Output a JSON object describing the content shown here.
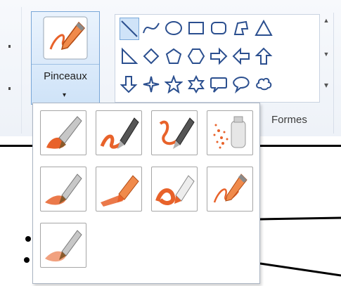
{
  "ribbon": {
    "brushes_button": {
      "label": "Pinceaux",
      "caret": "▾",
      "icon": "brush-pen-icon"
    },
    "shapes_group": {
      "label": "Formes",
      "shapes": [
        {
          "name": "line-icon",
          "selected": true
        },
        {
          "name": "curve-icon"
        },
        {
          "name": "oval-icon"
        },
        {
          "name": "rectangle-icon"
        },
        {
          "name": "rounded-rectangle-icon"
        },
        {
          "name": "polygon-icon"
        },
        {
          "name": "triangle-icon"
        },
        {
          "name": "right-triangle-icon"
        },
        {
          "name": "diamond-icon"
        },
        {
          "name": "pentagon-icon"
        },
        {
          "name": "hexagon-icon"
        },
        {
          "name": "right-arrow-icon"
        },
        {
          "name": "left-arrow-icon"
        },
        {
          "name": "up-arrow-icon"
        },
        {
          "name": "down-arrow-icon"
        },
        {
          "name": "four-point-star-icon"
        },
        {
          "name": "five-point-star-icon"
        },
        {
          "name": "six-point-star-icon"
        },
        {
          "name": "rounded-rect-callout-icon"
        },
        {
          "name": "oval-callout-icon"
        },
        {
          "name": "cloud-callout-icon"
        }
      ],
      "scroll": {
        "up": "▲",
        "down": "▼",
        "more": "▾"
      }
    }
  },
  "brush_menu": {
    "items": [
      {
        "name": "brush-icon"
      },
      {
        "name": "calligraphy-brush-1-icon"
      },
      {
        "name": "calligraphy-brush-2-icon"
      },
      {
        "name": "airbrush-icon"
      },
      {
        "name": "oil-brush-icon"
      },
      {
        "name": "crayon-icon"
      },
      {
        "name": "marker-icon"
      },
      {
        "name": "natural-pencil-icon"
      },
      {
        "name": "watercolor-brush-icon"
      }
    ]
  },
  "colors": {
    "accent": "#e8622a",
    "selection_border": "#79a7d8",
    "selection_fill": "#cfe3f8"
  }
}
